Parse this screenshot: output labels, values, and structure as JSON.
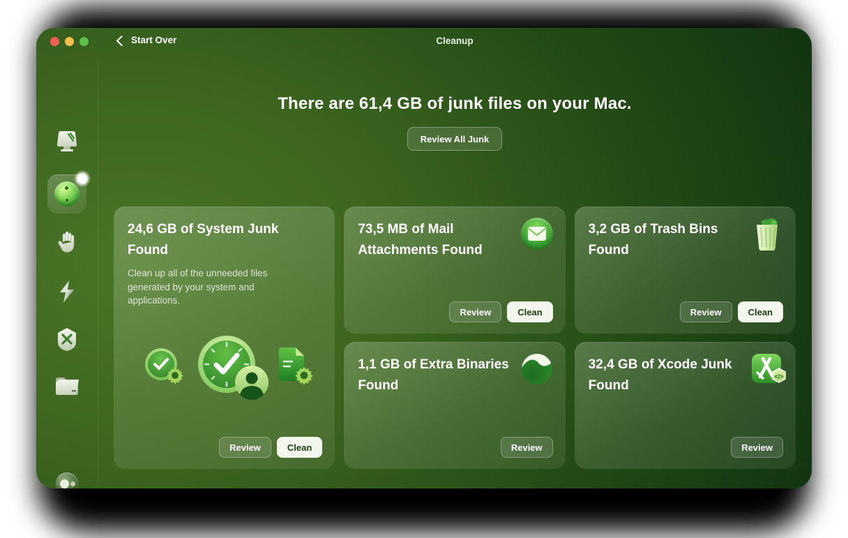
{
  "titlebar": {
    "back_label": "Start Over",
    "title": "Cleanup"
  },
  "main": {
    "headline": "There are 61,4 GB of junk files on your Mac.",
    "review_all_label": "Review All Junk"
  },
  "sidebar": {
    "items": [
      {
        "icon": "monitor-icon",
        "selected": false
      },
      {
        "icon": "cleanup-ball-icon",
        "selected": true,
        "badge": "glow-dot"
      },
      {
        "icon": "hand-icon",
        "selected": false
      },
      {
        "icon": "lightning-icon",
        "selected": false
      },
      {
        "icon": "apps-shield-icon",
        "selected": false
      },
      {
        "icon": "folder-icon",
        "selected": false
      }
    ],
    "footer_icon": "assistant-orb-icon"
  },
  "cards": [
    {
      "title": "24,6 GB of System Junk Found",
      "description": "Clean up all of the unneeded files generated by your system and applications.",
      "icons": [
        "clock-check-gear-icon",
        "clock-check-user-icon",
        "document-gear-icon"
      ],
      "review_label": "Review",
      "clean_label": "Clean"
    },
    {
      "title": "73,5 MB of Mail Attachments Found",
      "icon": "mail-icon",
      "review_label": "Review",
      "clean_label": "Clean"
    },
    {
      "title": "3,2 GB of Trash Bins Found",
      "icon": "trash-bin-icon",
      "review_label": "Review",
      "clean_label": "Clean"
    },
    {
      "title": "1,1 GB of Extra Binaries Found",
      "icon": "binaries-icon",
      "review_label": "Review"
    },
    {
      "title": "32,4 GB of Xcode Junk Found",
      "icon": "xcode-icon",
      "review_label": "Review"
    }
  ],
  "colors": {
    "traffic_red": "#f45f55",
    "traffic_yellow": "#f6be4f",
    "traffic_green": "#5fc04c",
    "background_dark_green": "#052408",
    "background_bright_green": "#4a7526",
    "clean_button_bg": "#f2f6ec",
    "clean_button_text": "#1e3c15",
    "accent_green": "#46aa38"
  }
}
